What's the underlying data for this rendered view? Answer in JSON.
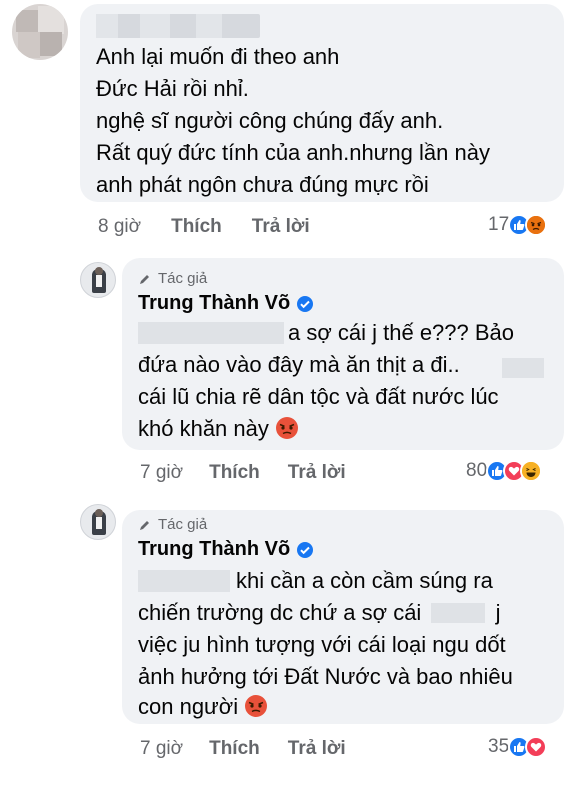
{
  "comment1": {
    "lines": [
      "Anh lại muốn đi theo anh",
      " Đức Hải rồi nhỉ.",
      "nghệ sĩ người công chúng đấy anh.",
      "Rất quý đức tính của anh.nhưng lần này",
      "anh phát ngôn chưa đúng mực rồi"
    ],
    "time": "8 giờ",
    "like_label": "Thích",
    "reply_label": "Trả lời",
    "reaction_count": "17",
    "reaction_icons": [
      "like-icon",
      "angry-icon"
    ]
  },
  "reply1": {
    "author_tag": "Tác giả",
    "author_name": "Trung Thành Võ",
    "lines": [
      "a sợ cái j thế e??? Bảo",
      "đứa nào vào đây mà ăn thịt a đi..",
      "cái lũ chia rẽ dân tộc và đất nước lúc",
      "khó khăn này"
    ],
    "time": "7 giờ",
    "like_label": "Thích",
    "reply_label": "Trả lời",
    "reaction_count": "80",
    "reaction_icons": [
      "like-icon",
      "love-icon",
      "haha-icon"
    ]
  },
  "reply2": {
    "author_tag": "Tác giả",
    "author_name": "Trung Thành Võ",
    "lines": [
      "khi cần a còn cầm súng ra",
      "chiến trường dc chứ a sợ cái",
      "việc ju hình tượng với cái loại ngu dốt",
      "ảnh hưởng tới Đất Nước và bao nhiêu",
      "con người"
    ],
    "line2_suffix": "j",
    "time": "7 giờ",
    "like_label": "Thích",
    "reply_label": "Trả lời",
    "reaction_count": "35",
    "reaction_icons": [
      "like-icon",
      "love-icon"
    ]
  },
  "colors": {
    "bubble": "#f0f2f5",
    "meta": "#65676b",
    "like": "#1877f2",
    "love": "#f33e58",
    "angry": "#e9710f",
    "haha": "#f7b125"
  }
}
